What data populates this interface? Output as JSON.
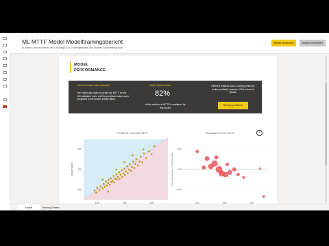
{
  "header": {
    "title": "ML MTTF Model Modelltrainingsbericht",
    "subtitle": "In diesem Bericht werden die Leistungs- und Trainingsdetails des Modells zusammengefasst.",
    "apply_button": "Modell anwenden",
    "edit_button": "Modell bearbeiten"
  },
  "section": {
    "title_line1": "MODEL",
    "title_line2": "PERFORMANCE"
  },
  "card": {
    "evaluated_title": "How the model was evaluated",
    "evaluated_text": "The model was used to predict the MTTF for the 100 validation rows, and the predicted values were compared to the known actual values.",
    "performance_title": "Model Performance",
    "performance_value": "82%",
    "performance_text": "of the variation in MTTF is explained by this model",
    "influence_text": "Different features have a varying influence on the predicted outcome. Click below for details.",
    "predictors_button": "See top predictors"
  },
  "tabs": [
    {
      "label": "Model Performance"
    },
    {
      "label": "Training Details"
    }
  ],
  "chart_data": [
    {
      "type": "scatter",
      "title": "Predicted vs Actual MTTF",
      "xlabel": "Predicted value",
      "ylabel": "Actual value",
      "x_ticks": [
        "100",
        "150",
        "200"
      ],
      "y_ticks": [
        "100",
        "150",
        "200"
      ],
      "xlim": [
        75,
        230
      ],
      "ylim": [
        75,
        225
      ],
      "points": [
        [
          95,
          98
        ],
        [
          98,
          93
        ],
        [
          100,
          104
        ],
        [
          104,
          99
        ],
        [
          106,
          108
        ],
        [
          110,
          103
        ],
        [
          112,
          114
        ],
        [
          114,
          107
        ],
        [
          116,
          120
        ],
        [
          118,
          110
        ],
        [
          120,
          116
        ],
        [
          121,
          124
        ],
        [
          123,
          112
        ],
        [
          125,
          128
        ],
        [
          126,
          119
        ],
        [
          128,
          122
        ],
        [
          130,
          134
        ],
        [
          131,
          118
        ],
        [
          133,
          127
        ],
        [
          135,
          138
        ],
        [
          136,
          125
        ],
        [
          138,
          131
        ],
        [
          140,
          143
        ],
        [
          141,
          126
        ],
        [
          143,
          137
        ],
        [
          145,
          148
        ],
        [
          146,
          131
        ],
        [
          148,
          140
        ],
        [
          150,
          152
        ],
        [
          151,
          136
        ],
        [
          153,
          145
        ],
        [
          155,
          158
        ],
        [
          156,
          141
        ],
        [
          158,
          150
        ],
        [
          160,
          163
        ],
        [
          162,
          147
        ],
        [
          164,
          156
        ],
        [
          166,
          170
        ],
        [
          168,
          154
        ],
        [
          170,
          164
        ],
        [
          172,
          176
        ],
        [
          175,
          160
        ],
        [
          178,
          170
        ],
        [
          180,
          182
        ],
        [
          183,
          168
        ],
        [
          186,
          190
        ],
        [
          190,
          178
        ],
        [
          195,
          195
        ],
        [
          200,
          188
        ],
        [
          205,
          208
        ],
        [
          165,
          185
        ],
        [
          150,
          168
        ],
        [
          135,
          150
        ],
        [
          185,
          200
        ],
        [
          120,
          95
        ],
        [
          110,
          125
        ]
      ],
      "shade_above_color": "#d6ecf7",
      "shade_below_color": "#f3d9e2",
      "point_color": "#c09b14"
    },
    {
      "type": "scatter",
      "title": "Residual error by MTTF",
      "xlabel": "Actual value",
      "ylabel": "Error (Actual value - Predicted value)",
      "x_ticks": [
        "100",
        "150",
        "200"
      ],
      "y_ticks": [
        "20%",
        "0%",
        "-20%"
      ],
      "xlim": [
        75,
        230
      ],
      "ylim": [
        -30,
        30
      ],
      "points": [
        {
          "x": 100,
          "y": 18,
          "r": 2.5
        },
        {
          "x": 112,
          "y": 2,
          "r": 3
        },
        {
          "x": 118,
          "y": 11,
          "r": 3.5
        },
        {
          "x": 125,
          "y": 3,
          "r": 4
        },
        {
          "x": 132,
          "y": 6,
          "r": 4.5
        },
        {
          "x": 140,
          "y": 0,
          "r": 5
        },
        {
          "x": 145,
          "y": -4,
          "r": 4.5
        },
        {
          "x": 152,
          "y": -5,
          "r": 4
        },
        {
          "x": 160,
          "y": -3,
          "r": 3.5
        },
        {
          "x": 168,
          "y": 0,
          "r": 3
        },
        {
          "x": 175,
          "y": -5,
          "r": 2.5
        },
        {
          "x": 135,
          "y": 12,
          "r": 3
        },
        {
          "x": 155,
          "y": 5,
          "r": 2.5
        },
        {
          "x": 185,
          "y": -8,
          "r": 2
        },
        {
          "x": 215,
          "y": 1,
          "r": 1.5
        },
        {
          "x": 222,
          "y": -27,
          "r": 2
        }
      ],
      "reference_line": 0,
      "point_color": "#e8555b",
      "reference_color": "#3aaa6d"
    }
  ]
}
